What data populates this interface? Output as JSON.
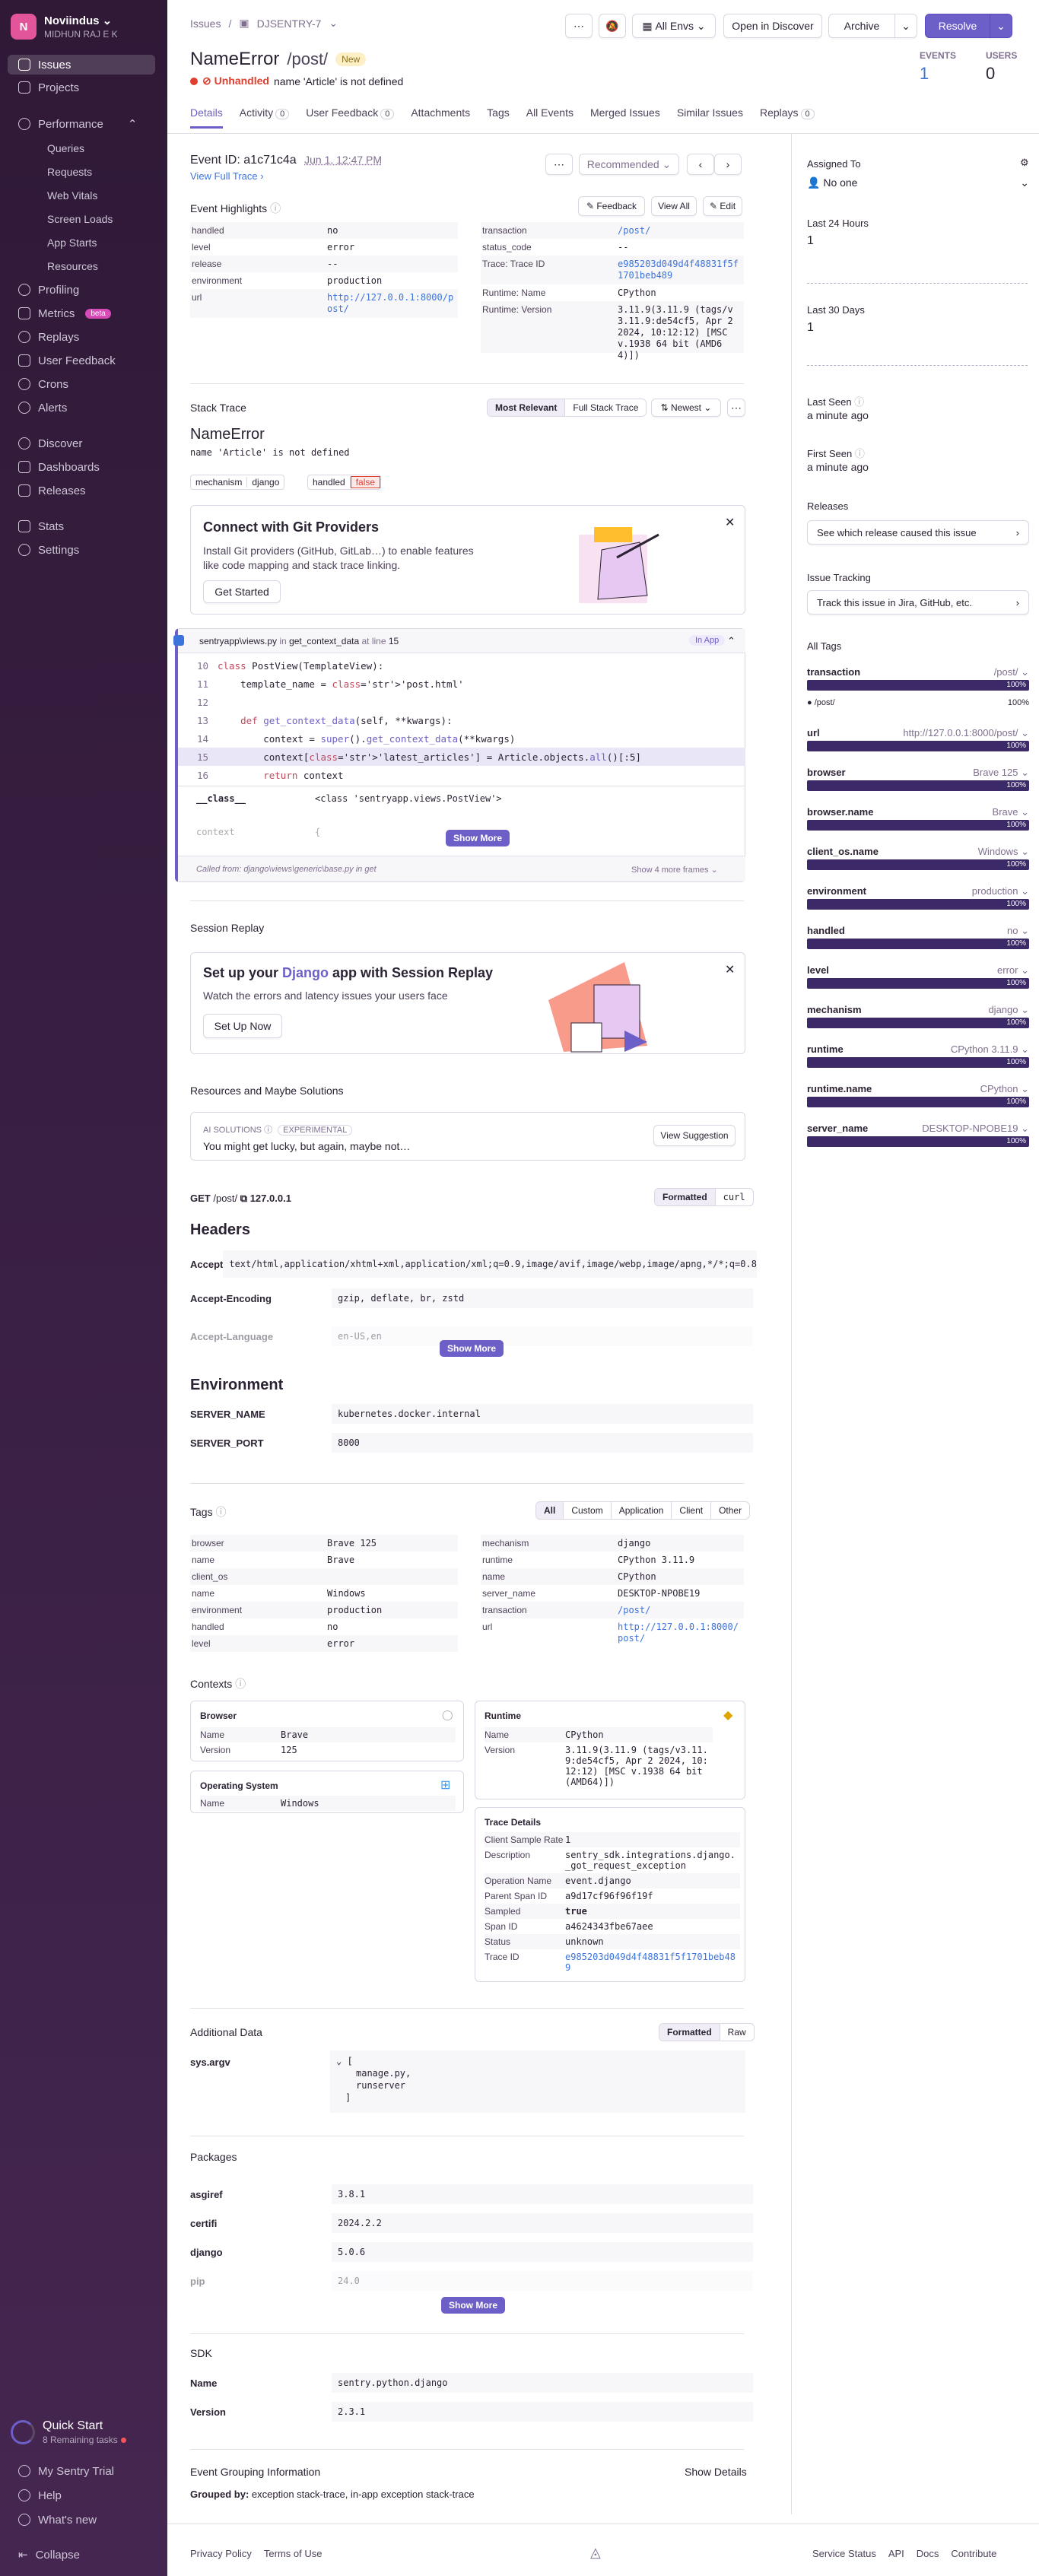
{
  "org": {
    "name": "Noviindus",
    "user": "MIDHUN RAJ E K",
    "initial": "N"
  },
  "nav": {
    "issues": "Issues",
    "projects": "Projects",
    "performance": "Performance",
    "queries": "Queries",
    "requests": "Requests",
    "web_vitals": "Web Vitals",
    "screen_loads": "Screen Loads",
    "app_starts": "App Starts",
    "resources": "Resources",
    "profiling": "Profiling",
    "metrics": "Metrics",
    "beta": "beta",
    "replays": "Replays",
    "user_feedback": "User Feedback",
    "crons": "Crons",
    "alerts": "Alerts",
    "discover": "Discover",
    "dashboards": "Dashboards",
    "releases": "Releases",
    "stats": "Stats",
    "settings": "Settings"
  },
  "quickstart": {
    "title": "Quick Start",
    "sub": "8 Remaining tasks"
  },
  "bottom_nav": {
    "trial": "My Sentry Trial",
    "help": "Help",
    "whats_new": "What's new",
    "collapse": "Collapse"
  },
  "header": {
    "crumb_issues": "Issues",
    "crumb_project": "DJSENTRY-7",
    "all_envs": "All Envs",
    "open_discover": "Open in Discover",
    "archive": "Archive",
    "resolve": "Resolve",
    "title": "NameError",
    "path": "/post/",
    "badge": "New",
    "unhandled": "Unhandled",
    "message": "name 'Article' is not defined",
    "events_label": "EVENTS",
    "events": "1",
    "users_label": "USERS",
    "users": "0"
  },
  "tabs": [
    {
      "label": "Details"
    },
    {
      "label": "Activity",
      "count": "0"
    },
    {
      "label": "User Feedback",
      "count": "0"
    },
    {
      "label": "Attachments"
    },
    {
      "label": "Tags"
    },
    {
      "label": "All Events"
    },
    {
      "label": "Merged Issues"
    },
    {
      "label": "Similar Issues"
    },
    {
      "label": "Replays",
      "count": "0"
    }
  ],
  "event": {
    "id_label": "Event ID:",
    "id": "a1c71c4a",
    "date": "Jun 1, 12:47 PM",
    "full_trace": "View Full Trace",
    "recommended": "Recommended"
  },
  "highlights": {
    "title": "Event Highlights",
    "feedback": "Feedback",
    "view_all": "View All",
    "edit": "Edit",
    "left": [
      [
        "handled",
        "no"
      ],
      [
        "level",
        "error"
      ],
      [
        "release",
        "--"
      ],
      [
        "environment",
        "production"
      ],
      [
        "url",
        "http://127.0.0.1:8000/post/"
      ]
    ],
    "right": [
      [
        "transaction",
        "/post/"
      ],
      [
        "status_code",
        "--"
      ],
      [
        "Trace: Trace ID",
        "e985203d049d4f48831f5f1701beb489"
      ],
      [
        "Runtime: Name",
        "CPython"
      ],
      [
        "Runtime: Version",
        "3.11.9(3.11.9 (tags/v3.11.9:de54cf5, Apr 2 2024, 10:12:12) [MSC v.1938 64 bit (AMD64)])"
      ]
    ]
  },
  "stack": {
    "title": "Stack Trace",
    "most_relevant": "Most Relevant",
    "full": "Full Stack Trace",
    "newest": "Newest",
    "error": "NameError",
    "msg": "name 'Article' is not defined",
    "mech_k": "mechanism",
    "mech_v": "django",
    "handled_k": "handled",
    "handled_v": "false"
  },
  "git": {
    "title": "Connect with Git Providers",
    "body": "Install Git providers (GitHub, GitLab…) to enable features like code mapping and stack trace linking.",
    "button": "Get Started"
  },
  "frame": {
    "file": "sentryapp\\views.py",
    "in": "in",
    "func": "get_context_data",
    "at": "at line",
    "line": "15",
    "in_app": "In App",
    "lines": [
      {
        "n": "10",
        "c": "class PostView(TemplateView):"
      },
      {
        "n": "11",
        "c": "    template_name = 'post.html'"
      },
      {
        "n": "12",
        "c": ""
      },
      {
        "n": "13",
        "c": "    def get_context_data(self, **kwargs):"
      },
      {
        "n": "14",
        "c": "        context = super().get_context_data(**kwargs)"
      },
      {
        "n": "15",
        "c": "        context['latest_articles'] = Article.objects.all()[:5]"
      },
      {
        "n": "16",
        "c": "        return context"
      }
    ],
    "var_class_k": "__class__",
    "var_class_v": "<class 'sentryapp.views.PostView'>",
    "var_ctx_k": "context",
    "var_ctx_v": "{",
    "show_more": "Show More",
    "called_from": "Called from: django\\views\\generic\\base.py",
    "in_get": "in get",
    "more_frames": "Show 4 more frames"
  },
  "replay": {
    "section": "Session Replay",
    "title_a": "Set up your ",
    "title_b": "Django",
    "title_c": " app with Session Replay",
    "body": "Watch the errors and latency issues your users face",
    "button": "Set Up Now"
  },
  "resources": {
    "section": "Resources and Maybe Solutions",
    "ai": "AI SOLUTIONS",
    "exp": "EXPERIMENTAL",
    "msg": "You might get lucky, but again, maybe not…",
    "button": "View Suggestion"
  },
  "request": {
    "method": "GET",
    "path": "/post/",
    "host": "127.0.0.1",
    "formatted": "Formatted",
    "curl": "curl",
    "headers_title": "Headers",
    "headers": [
      [
        "Accept",
        "text/html,application/xhtml+xml,application/xml;q=0.9,image/avif,image/webp,image/apng,*/*;q=0.8"
      ],
      [
        "Accept-Encoding",
        "gzip, deflate, br, zstd"
      ],
      [
        "Accept-Language",
        "en-US,en"
      ]
    ],
    "env_title": "Environment",
    "env": [
      [
        "SERVER_NAME",
        "kubernetes.docker.internal"
      ],
      [
        "SERVER_PORT",
        "8000"
      ]
    ],
    "show_more": "Show More"
  },
  "tags": {
    "title": "Tags",
    "filters": [
      "All",
      "Custom",
      "Application",
      "Client",
      "Other"
    ],
    "left": [
      [
        "browser",
        "Brave 125"
      ],
      [
        "  name",
        "Brave"
      ],
      [
        "client_os",
        ""
      ],
      [
        "  name",
        "Windows"
      ],
      [
        "environment",
        "production"
      ],
      [
        "handled",
        "no"
      ],
      [
        "level",
        "error"
      ]
    ],
    "right": [
      [
        "mechanism",
        "django"
      ],
      [
        "runtime",
        "CPython 3.11.9"
      ],
      [
        "  name",
        "CPython"
      ],
      [
        "server_name",
        "DESKTOP-NPOBE19"
      ],
      [
        "transaction",
        "/post/"
      ],
      [
        "url",
        "http://127.0.0.1:8000/post/"
      ]
    ]
  },
  "contexts": {
    "title": "Contexts",
    "browser": {
      "title": "Browser",
      "rows": [
        [
          "Name",
          "Brave"
        ],
        [
          "Version",
          "125"
        ]
      ]
    },
    "os": {
      "title": "Operating System",
      "rows": [
        [
          "Name",
          "Windows"
        ]
      ]
    },
    "runtime": {
      "title": "Runtime",
      "rows": [
        [
          "Name",
          "CPython"
        ],
        [
          "Version",
          "3.11.9(3.11.9 (tags/v3.11.9:de54cf5, Apr 2 2024, 10:12:12) [MSC v.1938 64 bit (AMD64)])"
        ]
      ]
    },
    "trace": {
      "title": "Trace Details",
      "rows": [
        [
          "Client Sample Rate",
          "1"
        ],
        [
          "Description",
          "sentry_sdk.integrations.django._got_request_exception"
        ],
        [
          "Operation Name",
          "event.django"
        ],
        [
          "Parent Span ID",
          "a9d17cf96f96f19f"
        ],
        [
          "Sampled",
          "true"
        ],
        [
          "Span ID",
          "a4624343fbe67aee"
        ],
        [
          "Status",
          "unknown"
        ],
        [
          "Trace ID",
          "e985203d049d4f48831f5f1701beb489"
        ]
      ]
    }
  },
  "additional": {
    "title": "Additional Data",
    "formatted": "Formatted",
    "raw": "Raw",
    "key": "sys.argv",
    "open": "[",
    "items": [
      "manage.py,",
      "runserver"
    ],
    "close": "]"
  },
  "packages": {
    "title": "Packages",
    "rows": [
      [
        "asgiref",
        "3.8.1"
      ],
      [
        "certifi",
        "2024.2.2"
      ],
      [
        "django",
        "5.0.6"
      ],
      [
        "pip",
        "24.0"
      ]
    ],
    "show_more": "Show More"
  },
  "sdk": {
    "title": "SDK",
    "rows": [
      [
        "Name",
        "sentry.python.django"
      ],
      [
        "Version",
        "2.3.1"
      ]
    ]
  },
  "grouping": {
    "title": "Event Grouping Information",
    "show": "Show Details",
    "label": "Grouped by:",
    "value": "exception stack-trace, in-app exception stack-trace"
  },
  "footer": {
    "privacy": "Privacy Policy",
    "terms": "Terms of Use",
    "status": "Service Status",
    "api": "API",
    "docs": "Docs",
    "contribute": "Contribute"
  },
  "aside": {
    "assigned": "Assigned To",
    "no_one": "No one",
    "last24": "Last 24 Hours",
    "v24": "1",
    "last30": "Last 30 Days",
    "v30": "1",
    "last_seen": "Last Seen",
    "last_seen_v": "a minute ago",
    "first_seen": "First Seen",
    "first_seen_v": "a minute ago",
    "releases": "Releases",
    "releases_btn": "See which release caused this issue",
    "tracking": "Issue Tracking",
    "tracking_btn": "Track this issue in Jira, GitHub, etc.",
    "all_tags": "All Tags",
    "tags": [
      {
        "name": "transaction",
        "value": "/post/",
        "pct": "100%"
      },
      {
        "name": "url",
        "value": "http://127.0.0.1:8000/post/",
        "pct": "100%"
      },
      {
        "name": "browser",
        "value": "Brave 125",
        "pct": "100%"
      },
      {
        "name": "browser.name",
        "value": "Brave",
        "pct": "100%"
      },
      {
        "name": "client_os.name",
        "value": "Windows",
        "pct": "100%"
      },
      {
        "name": "environment",
        "value": "production",
        "pct": "100%"
      },
      {
        "name": "handled",
        "value": "no",
        "pct": "100%"
      },
      {
        "name": "level",
        "value": "error",
        "pct": "100%"
      },
      {
        "name": "mechanism",
        "value": "django",
        "pct": "100%"
      },
      {
        "name": "runtime",
        "value": "CPython 3.11.9",
        "pct": "100%"
      },
      {
        "name": "runtime.name",
        "value": "CPython",
        "pct": "100%"
      },
      {
        "name": "server_name",
        "value": "DESKTOP-NPOBE19",
        "pct": "100%"
      }
    ],
    "tx_detail_value": "/post/",
    "tx_detail_pct": "100%"
  }
}
